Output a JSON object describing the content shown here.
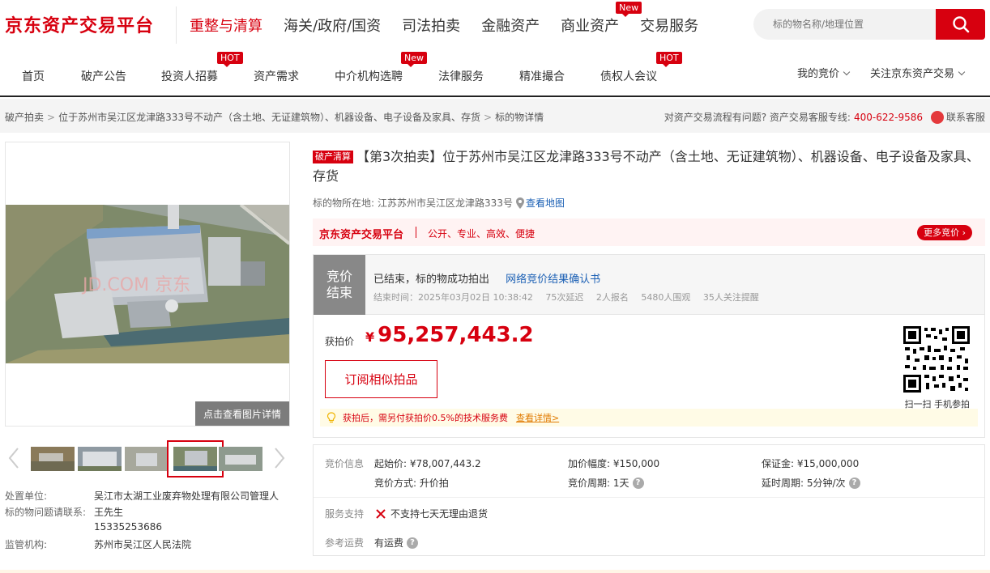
{
  "header": {
    "logo": "京东资产交易平台",
    "main_nav": [
      {
        "label": "重整与清算",
        "active": true
      },
      {
        "label": "海关/政府/国资"
      },
      {
        "label": "司法拍卖"
      },
      {
        "label": "金融资产"
      },
      {
        "label": "商业资产",
        "badge": "New"
      },
      {
        "label": "交易服务"
      }
    ],
    "search": {
      "placeholder": "标的物名称/地理位置"
    }
  },
  "sub_nav": {
    "items": [
      "首页",
      "破产公告",
      "投资人招募",
      "资产需求",
      "中介机构选聘",
      "法律服务",
      "精准撮合",
      "债权人会议"
    ],
    "badges": {
      "hot": "HOT",
      "new": "New"
    },
    "right": [
      "我的竞价",
      "关注京东资产交易"
    ]
  },
  "breadcrumb": {
    "items": [
      "破产拍卖",
      "位于苏州市吴江区龙津路333号不动产（含土地、无证建筑物）、机器设备、电子设备及家具、存货",
      "标的物详情"
    ],
    "hotline_text": "对资产交易流程有问题? 资产交易客服专线:",
    "hotline_number": "400-622-9586",
    "service_label": "联系客服"
  },
  "gallery": {
    "detail_label": "点击查看图片详情",
    "watermark": "JD.COM 京东"
  },
  "info": {
    "org_label": "处置单位:",
    "org_value": "吴江市太湖工业废弃物处理有限公司管理人",
    "contact_label": "标的物问题请联系:",
    "contact_name": "王先生",
    "contact_phone": "15335253686",
    "supervisor_label": "监管机构:",
    "supervisor_value": "苏州市吴江区人民法院"
  },
  "item": {
    "tag": "破产清算",
    "title": "【第3次拍卖】位于苏州市吴江区龙津路333号不动产（含土地、无证建筑物）、机器设备、电子设备及家具、存货",
    "location_label": "标的物所在地:",
    "location_value": "江苏苏州市吴江区龙津路333号",
    "map_link": "查看地图"
  },
  "slogan": {
    "brand": "京东资产交易平台",
    "motto": "公开、专业、高效、便捷",
    "more_btn": "更多竞价"
  },
  "auction": {
    "status_line1": "竞价",
    "status_line2": "结束",
    "main_text": "已结束，标的物成功拍出",
    "result_link": "网络竞价结果确认书",
    "end_time": "结束时间：2025年03月02日 10:38:42",
    "delays": "75次延迟",
    "signups": "2人报名",
    "viewers": "5480人围观",
    "followers": "35人关注提醒",
    "price_label": "获拍价",
    "currency": "¥",
    "price": "95,257,443.2",
    "subscribe_btn": "订阅相似拍品",
    "qr_label": "扫一扫 手机参拍",
    "notice": "获拍后，需另付获拍价0.5%的技术服务费",
    "notice_link": "查看详情>"
  },
  "params": {
    "section1": "竞价信息",
    "start_price": "起始价: ¥78,007,443.2",
    "increment": "加价幅度: ¥150,000",
    "deposit": "保证金: ¥15,000,000",
    "method": "竞价方式: 升价拍",
    "period": "竞价周期: 1天",
    "delay_period": "延时周期: 5分钟/次",
    "section2": "服务支持",
    "no_return": "不支持七天无理由退货",
    "section3": "参考运费",
    "shipping": "有运费"
  }
}
